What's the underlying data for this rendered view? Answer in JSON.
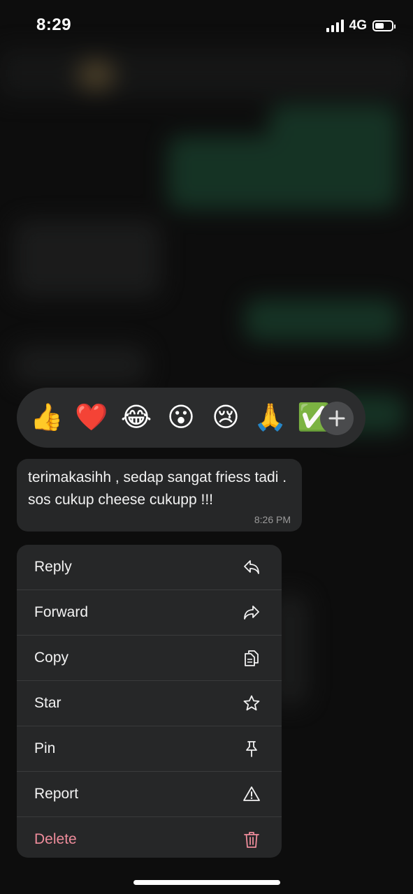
{
  "status_bar": {
    "time": "8:29",
    "network": "4G",
    "battery_level": 0.55
  },
  "reactions": [
    {
      "emoji": "👍",
      "name": "thumbs-up"
    },
    {
      "emoji": "❤️",
      "name": "red-heart"
    },
    {
      "emoji": "😂",
      "name": "tears-of-joy"
    },
    {
      "emoji": "😮",
      "name": "surprised"
    },
    {
      "emoji": "😢",
      "name": "crying"
    },
    {
      "emoji": "🙏",
      "name": "folded-hands"
    },
    {
      "emoji": "✅",
      "name": "check-mark"
    }
  ],
  "message": {
    "text": "terimakasihh , sedap sangat friess tadi . sos cukup cheese cukupp !!!",
    "time": "8:26 PM"
  },
  "menu": {
    "reply": "Reply",
    "forward": "Forward",
    "copy": "Copy",
    "star": "Star",
    "pin": "Pin",
    "report": "Report",
    "delete": "Delete"
  },
  "colors": {
    "danger": "#ee8c9b",
    "menu_bg": "#262728"
  }
}
